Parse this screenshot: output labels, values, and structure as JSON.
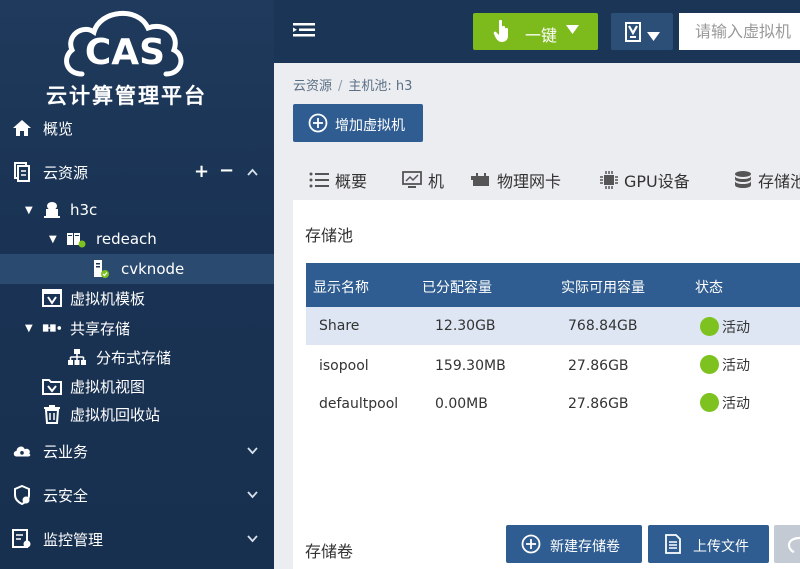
{
  "sidebar": {
    "logo_text": "CAS",
    "title": "云计算管理平台",
    "items": [
      {
        "label": "概览",
        "icon": "home-icon"
      },
      {
        "label": "云资源",
        "icon": "cloud-resource-icon"
      },
      {
        "label": "h3c",
        "icon": "datacenter-icon"
      },
      {
        "label": "redeach",
        "icon": "host-pool-icon"
      },
      {
        "label": "cvknode",
        "icon": "host-icon"
      },
      {
        "label": "虚拟机模板",
        "icon": "vm-template-icon"
      },
      {
        "label": "共享存储",
        "icon": "shared-storage-icon"
      },
      {
        "label": "分布式存储",
        "icon": "distributed-storage-icon"
      },
      {
        "label": "虚拟机视图",
        "icon": "vm-view-icon"
      },
      {
        "label": "虚拟机回收站",
        "icon": "recycle-bin-icon"
      },
      {
        "label": "云业务",
        "icon": "cloud-service-icon"
      },
      {
        "label": "云安全",
        "icon": "cloud-security-icon"
      },
      {
        "label": "监控管理",
        "icon": "monitor-icon"
      }
    ],
    "plus": "+",
    "minus": "−"
  },
  "header": {
    "oneclick_label": "一键",
    "search_placeholder": "请输入虚拟机"
  },
  "breadcrumb": {
    "items": [
      "云资源",
      "主机池: h3"
    ],
    "sep": "/"
  },
  "add_vm_label": "增加虚拟机",
  "tabs": [
    {
      "label": "概要"
    },
    {
      "label": "机"
    },
    {
      "label": "物理网卡"
    },
    {
      "label": "GPU设备"
    },
    {
      "label": "存储池"
    }
  ],
  "storage_pool": {
    "title": "存储池",
    "columns": [
      "显示名称",
      "已分配容量",
      "实际可用容量",
      "状态"
    ],
    "rows": [
      {
        "name": "Share",
        "allocated": "12.30GB",
        "available": "768.84GB",
        "status": "活动"
      },
      {
        "name": "isopool",
        "allocated": "159.30MB",
        "available": "27.86GB",
        "status": "活动"
      },
      {
        "name": "defaultpool",
        "allocated": "0.00MB",
        "available": "27.86GB",
        "status": "活动"
      }
    ]
  },
  "storage_volume": {
    "title": "存储卷",
    "new_label": "新建存储卷",
    "upload_label": "上传文件"
  },
  "colors": {
    "sidebar_bg": "#1b3556",
    "header_bg": "#1b3556",
    "accent_green": "#7dbb1d",
    "primary_blue": "#2f5d91",
    "status_green": "#7dc21e"
  }
}
